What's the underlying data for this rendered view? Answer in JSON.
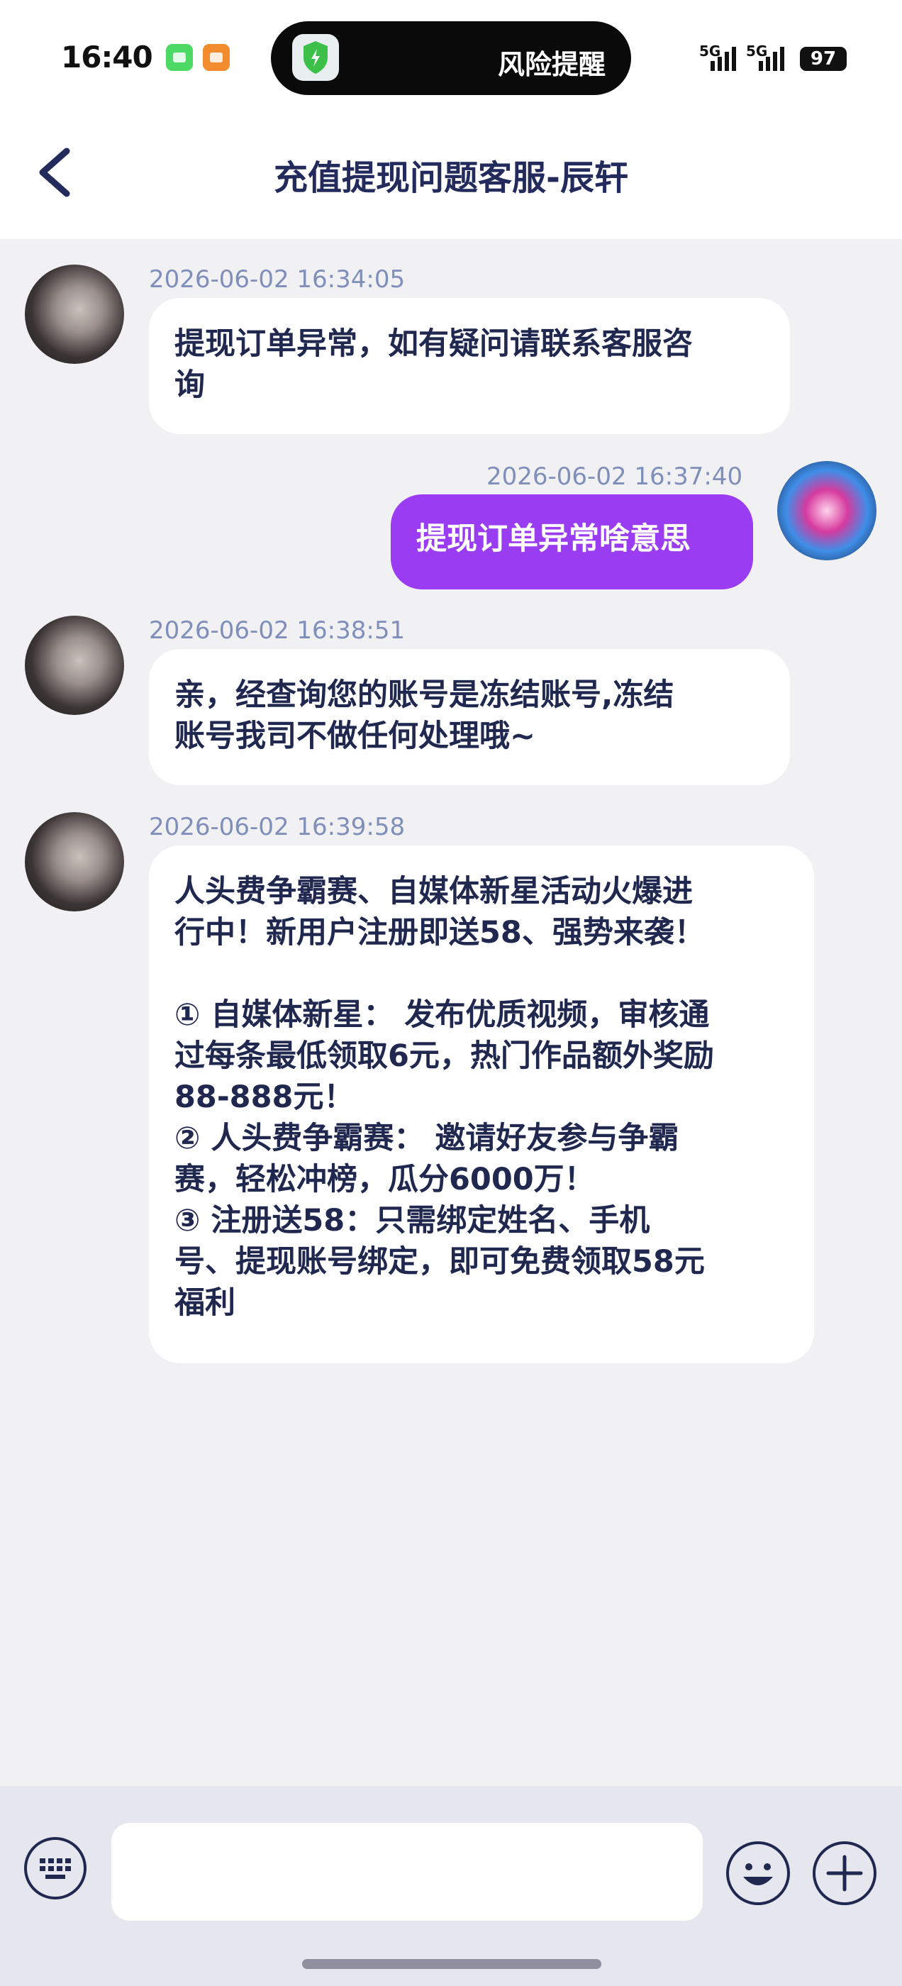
{
  "status_bar": {
    "time": "16:40",
    "island_text": "风险提醒",
    "signal_1": "5G",
    "signal_2": "5G",
    "battery": "97"
  },
  "header": {
    "title": "充值提现问题客服-辰轩"
  },
  "messages": [
    {
      "sender": "agent",
      "timestamp": "2026-06-02 16:34:05",
      "lines": [
        "提现订单异常，如有疑问请联系客服咨",
        "询"
      ]
    },
    {
      "sender": "user",
      "timestamp": "2026-06-02 16:37:40",
      "lines": [
        "提现订单异常啥意思"
      ]
    },
    {
      "sender": "agent",
      "timestamp": "2026-06-02 16:38:51",
      "lines": [
        "亲，经查询您的账号是冻结账号,冻结",
        "账号我司不做任何处理哦~"
      ]
    },
    {
      "sender": "agent",
      "timestamp": "2026-06-02 16:39:58",
      "lines": [
        "人头费争霸赛、自媒体新星活动火爆进",
        "行中！新用户注册即送58、强势来袭！",
        " ",
        "① 自媒体新星： 发布优质视频，审核通",
        "过每条最低领取6元，热门作品额外奖励",
        "88-888元！",
        "② 人头费争霸赛： 邀请好友参与争霸",
        "赛，轻松冲榜，瓜分6000万！",
        "③ 注册送58：只需绑定姓名、手机",
        "号、提现账号绑定，即可免费领取58元",
        "福利"
      ]
    }
  ],
  "colors": {
    "accent": "#9a3cf2",
    "text": "#20284f",
    "timestamp": "#7f8fba",
    "background": "#f1f1f4"
  },
  "icons": {
    "back": "chevron-left-icon",
    "keyboard": "keyboard-icon",
    "emoji": "smiley-icon",
    "plus": "plus-circle-icon"
  }
}
